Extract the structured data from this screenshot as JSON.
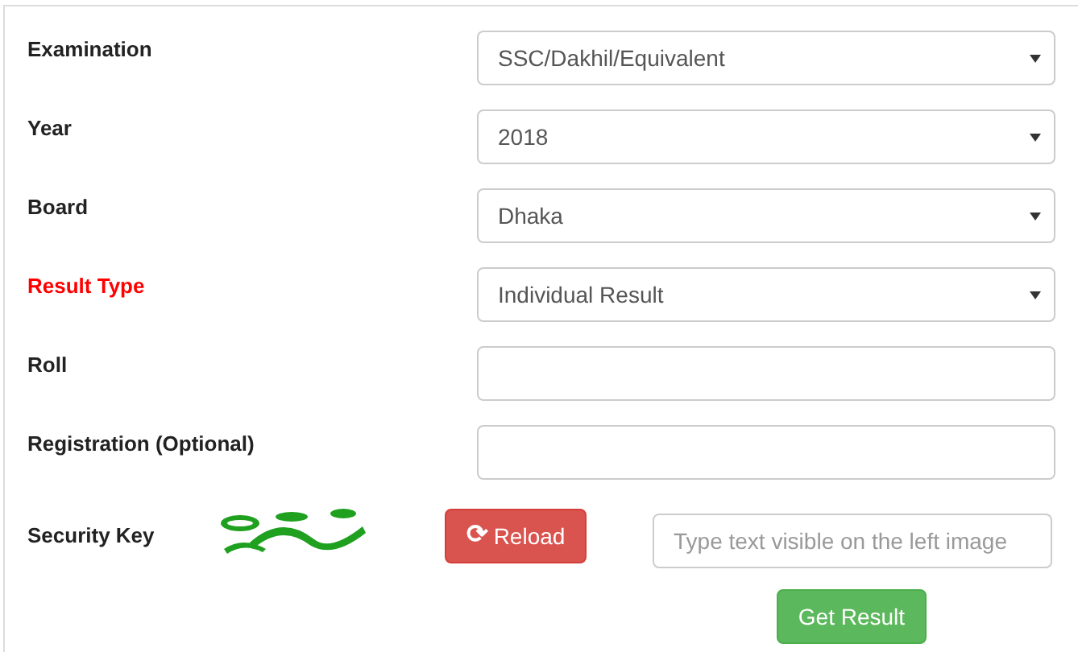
{
  "fields": [
    {
      "label": "Examination",
      "highlighted": false,
      "kind": "select",
      "value": "SSC/Dakhil/Equivalent"
    },
    {
      "label": "Year",
      "highlighted": false,
      "kind": "select",
      "value": "2018"
    },
    {
      "label": "Board",
      "highlighted": false,
      "kind": "select",
      "value": "Dhaka"
    },
    {
      "label": "Result Type",
      "highlighted": true,
      "kind": "select",
      "value": "Individual Result"
    },
    {
      "label": "Roll",
      "highlighted": false,
      "kind": "input"
    },
    {
      "label": "Registration (Optional)",
      "highlighted": false,
      "kind": "input"
    }
  ],
  "security": {
    "label": "Security Key",
    "reload_button": {
      "icon": "⟳",
      "label": "Reload"
    },
    "input": {
      "placeholder": "Type text visible on the left image"
    }
  },
  "submit_button": "Get Result"
}
